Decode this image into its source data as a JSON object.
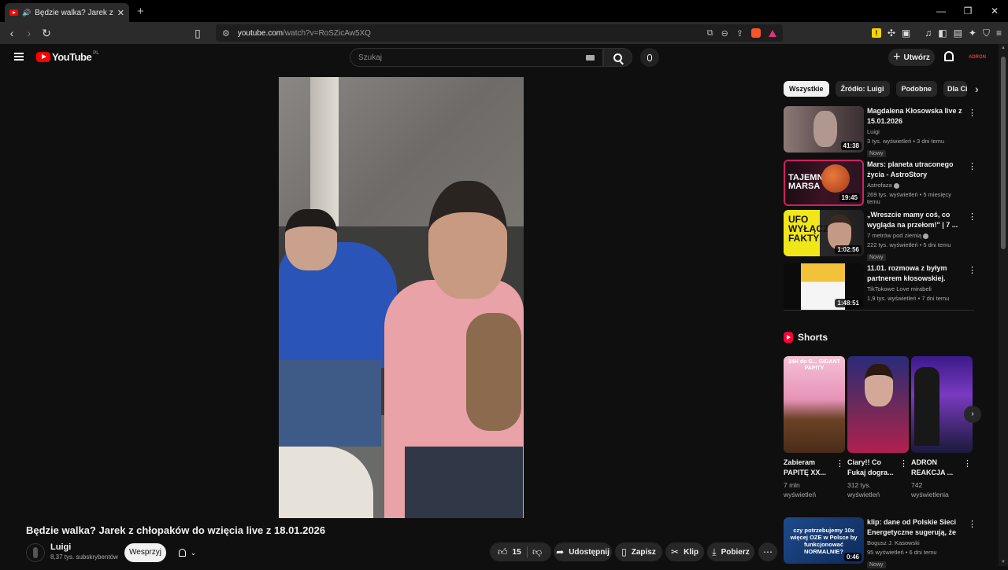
{
  "browser": {
    "tab_title": "Będzie walka? Jarek z chłopaków do wzięcia live z 18.01.2026",
    "url_host": "youtube.com",
    "url_path": "/watch?v=RoSZicAw5XQ"
  },
  "masthead": {
    "logo_text": "YouTube",
    "country_code": "PL",
    "search_placeholder": "Szukaj",
    "create_label": "Utwórz",
    "avatar_text": "ADRON"
  },
  "video": {
    "title": "Będzie walka? Jarek z chłopaków do wzięcia live z 18.01.2026",
    "channel": "Luigi",
    "subscribers": "8,37 tys. subskrybentów",
    "join_label": "Wesprzyj",
    "likes": "15",
    "share_label": "Udostępnij",
    "save_label": "Zapisz",
    "clip_label": "Klip",
    "download_label": "Pobierz"
  },
  "chips": [
    "Wszystkie",
    "Źródło: Luigi",
    "Podobne",
    "Dla Ciebie"
  ],
  "recommendations": [
    {
      "title": "Magdalena Kłosowska live z 15.01.2026",
      "channel": "Luigi",
      "meta": "3 tys. wyświetleń • 3 dni temu",
      "duration": "41:38",
      "badge": "Nowy",
      "thumb_text": ""
    },
    {
      "title": "Mars: planeta utraconego życia - AstroStory",
      "channel": "Astrofaza",
      "meta": "269 tys. wyświetleń • 5 miesięcy temu",
      "duration": "19:45",
      "badge": "",
      "thumb_text": "TAJEMNICE MARSA"
    },
    {
      "title": "„Wreszcie mamy coś, co wygląda na przełom!\" | 7 ...",
      "channel": "7 metrów pod ziemią",
      "meta": "222 tys. wyświetleń • 5 dni temu",
      "duration": "1:02:56",
      "badge": "Nowy",
      "thumb_text": "UFO WYŁĄCZNE FAKTY"
    },
    {
      "title": "11.01. rozmowa z byłym partnerem kłosowskiej.",
      "channel": "TikTokowe Love mirabeli",
      "meta": "1,9 tys. wyświetleń • 7 dni temu",
      "duration": "1:48:51",
      "badge": "",
      "thumb_text": ""
    }
  ],
  "shorts": {
    "heading": "Shorts",
    "items": [
      {
        "title": "Zabieram PAPITĘ XX...",
        "views": "7 mln wyświetleń",
        "thumb_text": "24H do G... GIGANT PAPITY"
      },
      {
        "title": "Ciary!! Co Fukaj dogra...",
        "views": "312 tys. wyświetleń",
        "thumb_text": ""
      },
      {
        "title": "ADRON REAKCJA ...",
        "views": "742 wyświetlenia",
        "thumb_text": ""
      }
    ]
  },
  "bottom_rec": {
    "title": "klip: dane od Polskie Sieci Energetyczne sugerują, że zim...",
    "channel": "Bogusz J. Kasowski",
    "meta": "95 wyświetleń • 6 dni temu",
    "duration": "0:46",
    "badge": "Nowy",
    "thumb_text": "czy potrzebujemy 10x więcej OZE w Polsce by funkcjonować NORMALNIE?"
  }
}
